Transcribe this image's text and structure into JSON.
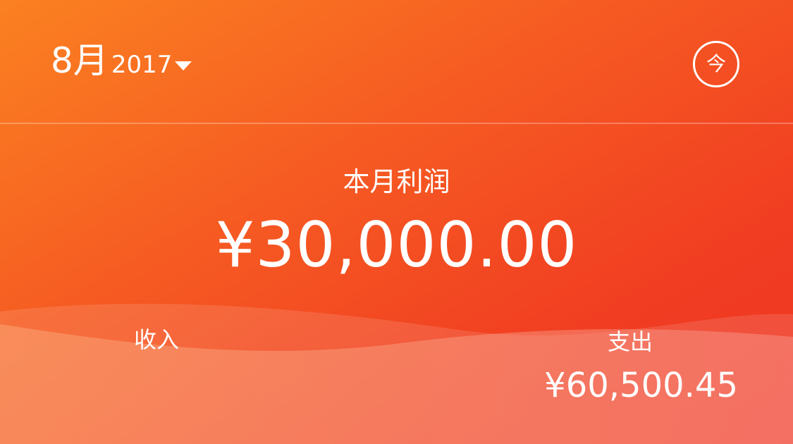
{
  "header": {
    "month_label": "8月",
    "year_label": "2017",
    "today_button_label": "今"
  },
  "summary": {
    "profit_label": "本月利润",
    "profit_amount": "¥30,000.00"
  },
  "income": {
    "label": "收入"
  },
  "expense": {
    "label": "支出",
    "amount": "¥60,500.45"
  },
  "colors": {
    "gradient_start": "#fb8121",
    "gradient_end": "#ee3322",
    "text": "#ffffff"
  }
}
